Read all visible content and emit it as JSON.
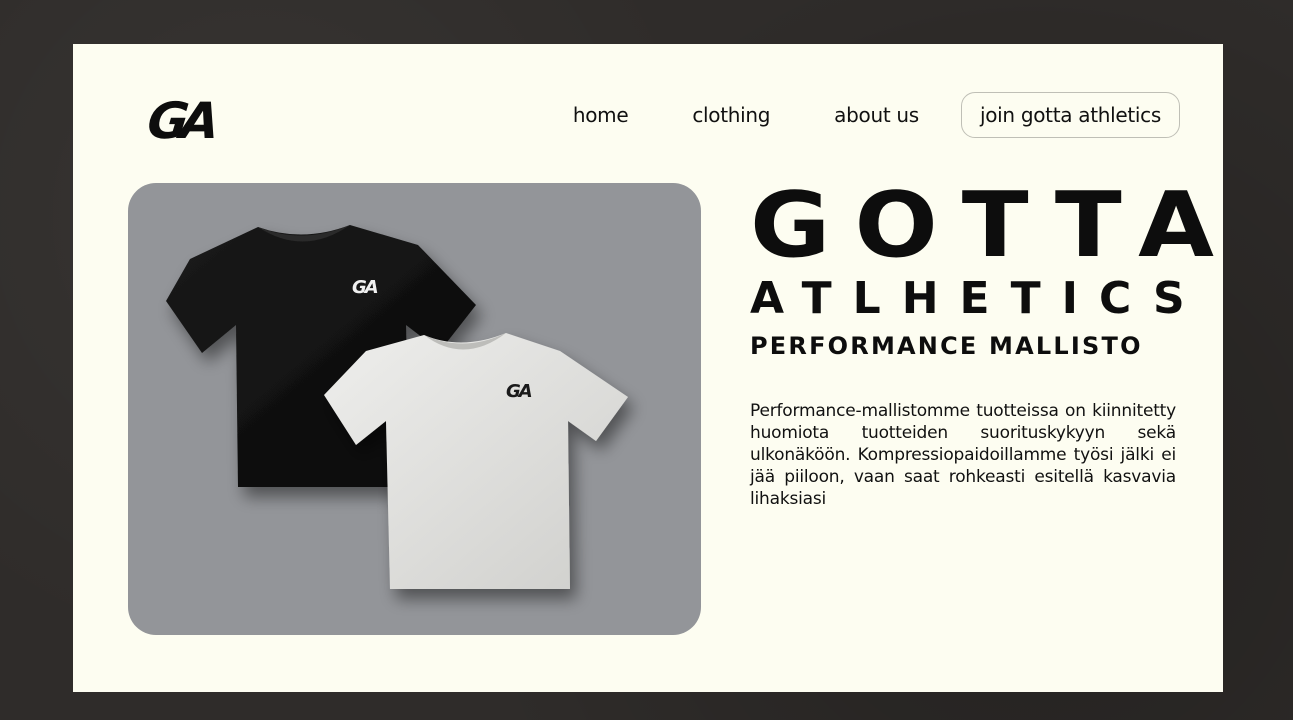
{
  "brand": {
    "logo_text": "GA"
  },
  "nav": {
    "items": [
      {
        "label": "home"
      },
      {
        "label": "clothing"
      },
      {
        "label": "about us"
      }
    ],
    "cta_label": "join gotta athletics"
  },
  "hero": {
    "title_line1": "GOTTA",
    "title_line2": "ATLHETICS",
    "title_line3": "PERFORMANCE MALLISTO",
    "description": "Performance-mallistomme tuotteissa on kiinnitetty huomiota tuotteiden suorituskykyyn sekä ulkonäköön. Kompressiopaidoillamme työsi jälki ei jää piiloon, vaan saat rohkeasti esitellä kasvavia lihaksiasi"
  },
  "product_image": {
    "shirt_logo_text": "GA"
  },
  "colors": {
    "page_bg": "#2f2c2a",
    "frame_bg": "#fdfdf1",
    "card_bg": "#939599",
    "text": "#0d0d0d"
  }
}
